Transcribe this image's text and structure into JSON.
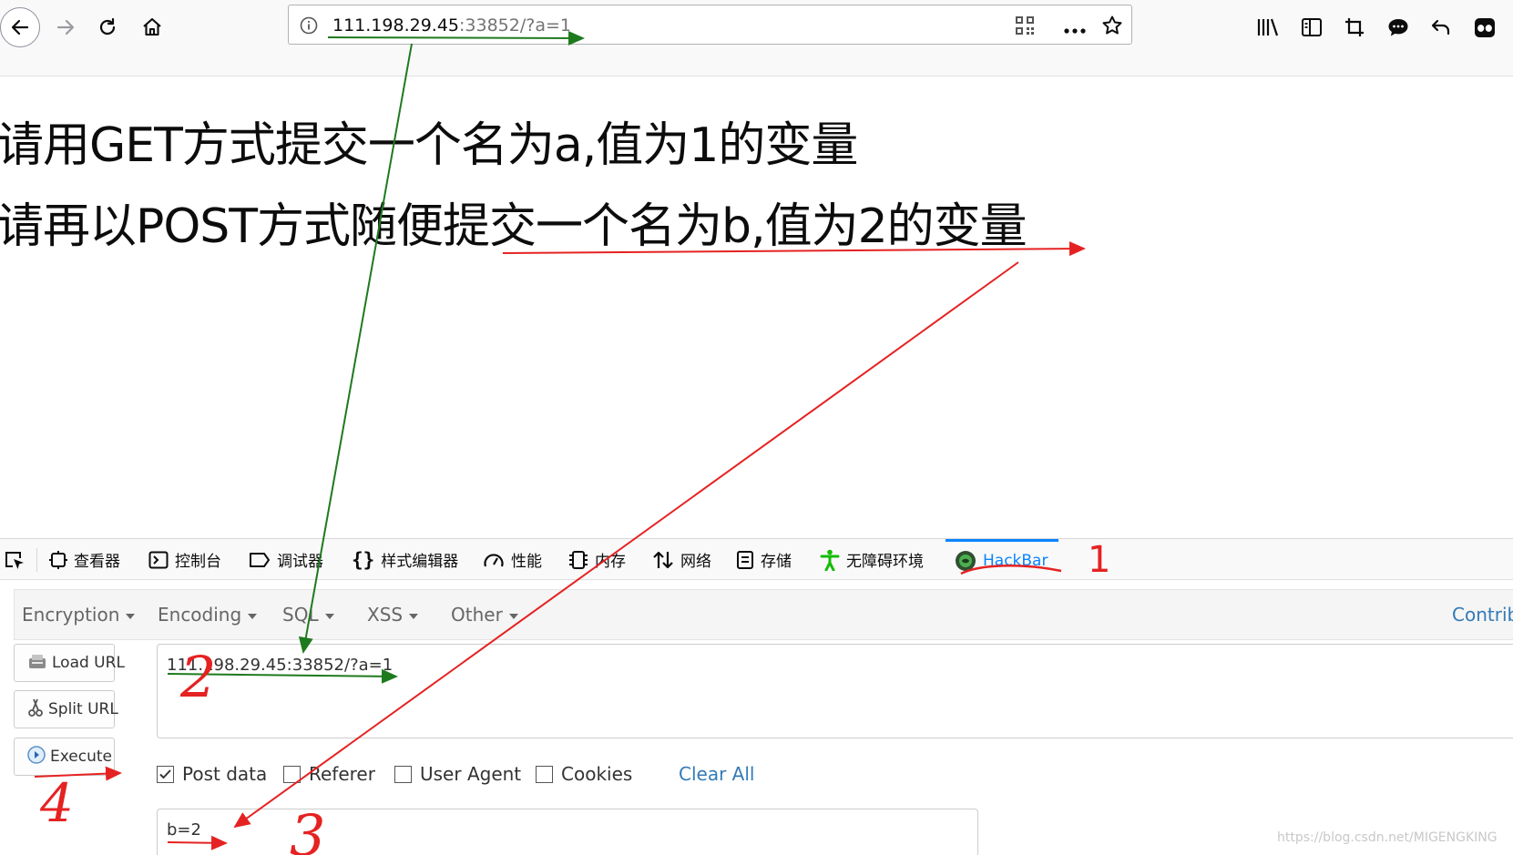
{
  "browser": {
    "url_host": "111.198.29.45",
    "url_rest": ":33852/?a=1"
  },
  "page": {
    "line1": "请用GET方式提交一个名为a,值为1的变量",
    "line2": "请再以POST方式随便提交一个名为b,值为2的变量"
  },
  "devtools": {
    "tabs": [
      "查看器",
      "控制台",
      "调试器",
      "样式编辑器",
      "性能",
      "内存",
      "网络",
      "存储",
      "无障碍环境",
      "HackBar"
    ],
    "active_tab": "HackBar"
  },
  "hackbar": {
    "menu": [
      "Encryption",
      "Encoding",
      "SQL",
      "XSS",
      "Other"
    ],
    "contribute": "Contrib",
    "buttons": {
      "load": "Load URL",
      "split": "Split URL",
      "execute": "Execute"
    },
    "url_value": "111.198.29.45:33852/?a=1",
    "options": {
      "post_data": "Post data",
      "referer": "Referer",
      "user_agent": "User Agent",
      "cookies": "Cookies",
      "post_data_checked": true,
      "referer_checked": false,
      "user_agent_checked": false,
      "cookies_checked": false
    },
    "clear_all": "Clear All",
    "post_value": "b=2"
  },
  "annotations": {
    "n1": "1",
    "n2": "2",
    "n3": "3",
    "n4": "4"
  },
  "watermark": "https://blog.csdn.net/MIGENGKING",
  "colors": {
    "accent": "#0a84ff",
    "link": "#337ab7",
    "annot_red": "#e52222",
    "annot_green": "#1e7a1e"
  }
}
